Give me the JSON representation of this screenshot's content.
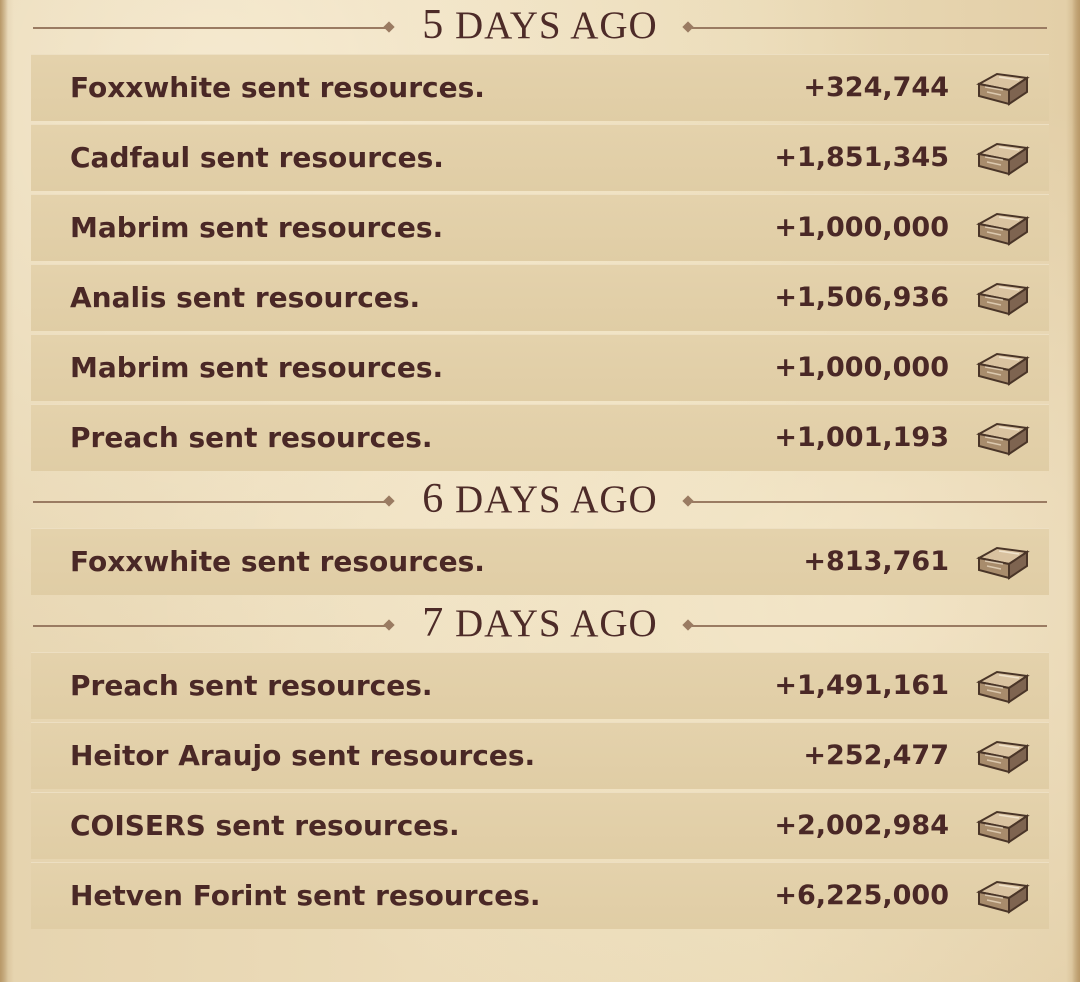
{
  "sections": [
    {
      "count": "5",
      "label": "DAYS AGO",
      "entries": [
        {
          "text": "Foxxwhite sent resources.",
          "amount": "+324,744",
          "icon": "resource-crate-icon"
        },
        {
          "text": "Cadfaul sent resources.",
          "amount": "+1,851,345",
          "icon": "resource-crate-icon"
        },
        {
          "text": "Mabrim sent resources.",
          "amount": "+1,000,000",
          "icon": "resource-crate-icon"
        },
        {
          "text": "Analis sent resources.",
          "amount": "+1,506,936",
          "icon": "resource-crate-icon"
        },
        {
          "text": "Mabrim sent resources.",
          "amount": "+1,000,000",
          "icon": "resource-crate-icon"
        },
        {
          "text": "Preach sent resources.",
          "amount": "+1,001,193",
          "icon": "resource-crate-icon"
        }
      ]
    },
    {
      "count": "6",
      "label": "DAYS AGO",
      "entries": [
        {
          "text": "Foxxwhite sent resources.",
          "amount": "+813,761",
          "icon": "resource-crate-icon"
        }
      ]
    },
    {
      "count": "7",
      "label": "DAYS AGO",
      "entries": [
        {
          "text": "Preach sent resources.",
          "amount": "+1,491,161",
          "icon": "resource-crate-icon"
        },
        {
          "text": "Heitor Araujo sent resources.",
          "amount": "+252,477",
          "icon": "resource-crate-icon"
        },
        {
          "text": "COISERS sent resources.",
          "amount": "+2,002,984",
          "icon": "resource-crate-icon"
        },
        {
          "text": "Hetven Forint sent resources.",
          "amount": "+6,225,000",
          "icon": "resource-crate-icon"
        }
      ]
    }
  ],
  "colors": {
    "text": "#4a2826",
    "row_background": "#e2cfa8",
    "parchment": "#eadab6",
    "divider": "#9a7b62"
  }
}
